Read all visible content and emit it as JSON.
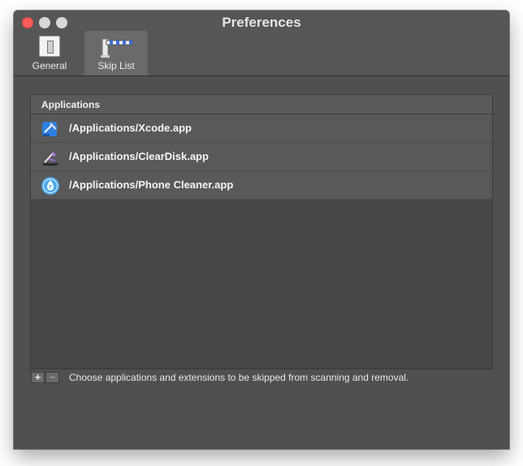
{
  "window": {
    "title": "Preferences"
  },
  "tabs": [
    {
      "label": "General",
      "icon": "switch-icon",
      "selected": false
    },
    {
      "label": "Skip List",
      "icon": "barrier-gate-icon",
      "selected": true
    }
  ],
  "skip_list": {
    "column_header": "Applications",
    "items": [
      {
        "path": "/Applications/Xcode.app",
        "icon": "xcode-icon"
      },
      {
        "path": "/Applications/ClearDisk.app",
        "icon": "cleardisk-icon"
      },
      {
        "path": "/Applications/Phone Cleaner.app",
        "icon": "phone-cleaner-icon"
      }
    ],
    "add_label": "+",
    "remove_label": "−",
    "hint": "Choose applications and extensions to be skipped from scanning and removal."
  },
  "colors": {
    "close": "#fc5b57",
    "window_bg": "#505050",
    "row_bg": "#595959"
  }
}
